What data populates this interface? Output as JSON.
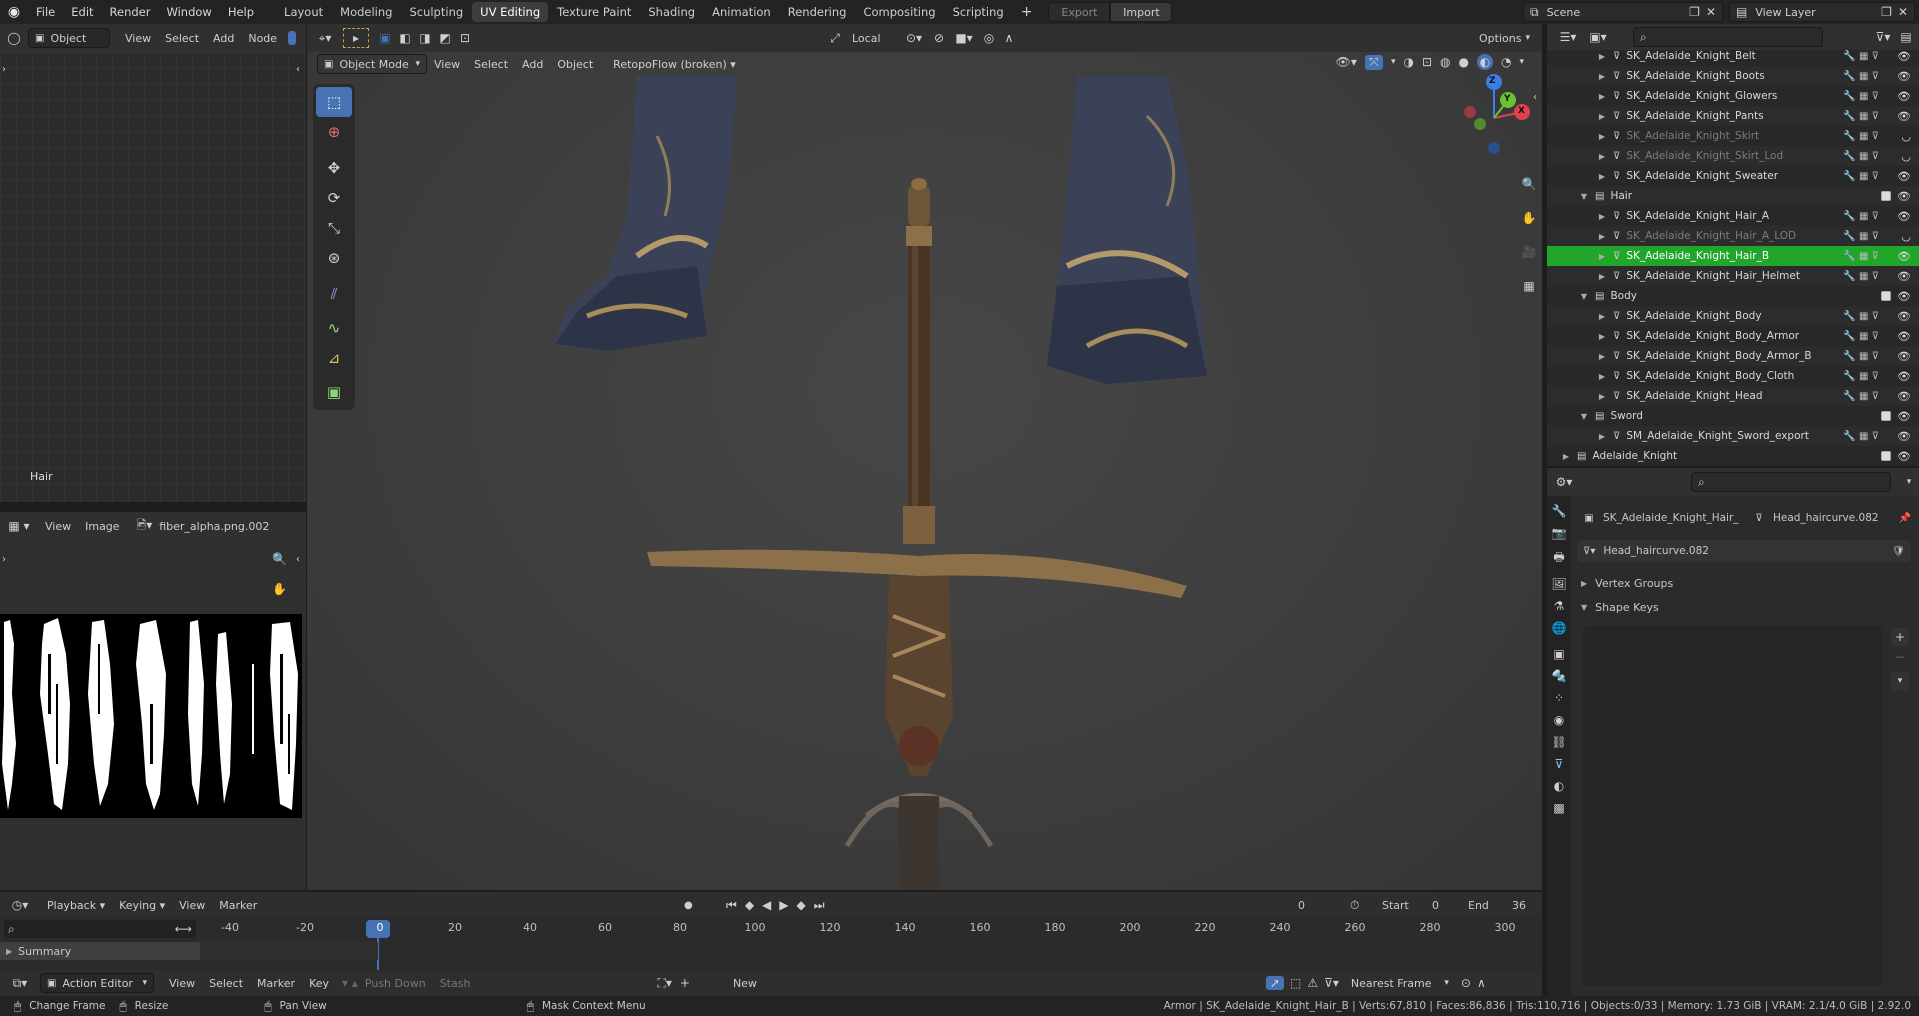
{
  "app_menu": [
    "File",
    "Edit",
    "Render",
    "Window",
    "Help"
  ],
  "workspace_tabs": [
    "Layout",
    "Modeling",
    "Sculpting",
    "UV Editing",
    "Texture Paint",
    "Shading",
    "Animation",
    "Rendering",
    "Compositing",
    "Scripting"
  ],
  "active_tab_index": 3,
  "top_right": {
    "export": "Export",
    "import": "Import",
    "scene": "Scene",
    "view_layer": "View Layer"
  },
  "uv_editor": {
    "mode": "Object",
    "menus": [
      "View",
      "Select",
      "Add",
      "Node"
    ],
    "label": "Hair"
  },
  "image_editor": {
    "menus": [
      "View",
      "Image"
    ],
    "image_name": "fiber_alpha.png.002"
  },
  "viewport_header": {
    "transform_orientation": "Local",
    "options": "Options",
    "mode": "Object Mode",
    "menus": [
      "View",
      "Select",
      "Add",
      "Object"
    ],
    "addon_menu": "RetopoFlow (broken)"
  },
  "gizmo_axes": {
    "x": "X",
    "y": "Y",
    "z": "Z"
  },
  "outliner": {
    "rows": [
      {
        "label": "SK_Adelaide_Knight_Belt",
        "indent": 2,
        "dim": false,
        "sel": false
      },
      {
        "label": "SK_Adelaide_Knight_Boots",
        "indent": 2,
        "dim": false,
        "sel": false
      },
      {
        "label": "SK_Adelaide_Knight_Glowers",
        "indent": 2,
        "dim": false,
        "sel": false
      },
      {
        "label": "SK_Adelaide_Knight_Pants",
        "indent": 2,
        "dim": false,
        "sel": false
      },
      {
        "label": "SK_Adelaide_Knight_Skirt",
        "indent": 2,
        "dim": true,
        "sel": false
      },
      {
        "label": "SK_Adelaide_Knight_Skirt_Lod",
        "indent": 2,
        "dim": true,
        "sel": false
      },
      {
        "label": "SK_Adelaide_Knight_Sweater",
        "indent": 2,
        "dim": false,
        "sel": false
      },
      {
        "label": "Hair",
        "indent": 1,
        "dim": false,
        "sel": false,
        "collection": true
      },
      {
        "label": "SK_Adelaide_Knight_Hair_A",
        "indent": 2,
        "dim": false,
        "sel": false
      },
      {
        "label": "SK_Adelaide_Knight_Hair_A_LOD",
        "indent": 2,
        "dim": true,
        "sel": false
      },
      {
        "label": "SK_Adelaide_Knight_Hair_B",
        "indent": 2,
        "dim": false,
        "sel": true
      },
      {
        "label": "SK_Adelaide_Knight_Hair_Helmet",
        "indent": 2,
        "dim": false,
        "sel": false
      },
      {
        "label": "Body",
        "indent": 1,
        "dim": false,
        "sel": false,
        "collection": true
      },
      {
        "label": "SK_Adelaide_Knight_Body",
        "indent": 2,
        "dim": false,
        "sel": false
      },
      {
        "label": "SK_Adelaide_Knight_Body_Armor",
        "indent": 2,
        "dim": false,
        "sel": false
      },
      {
        "label": "SK_Adelaide_Knight_Body_Armor_B",
        "indent": 2,
        "dim": false,
        "sel": false
      },
      {
        "label": "SK_Adelaide_Knight_Body_Cloth",
        "indent": 2,
        "dim": false,
        "sel": false
      },
      {
        "label": "SK_Adelaide_Knight_Head",
        "indent": 2,
        "dim": false,
        "sel": false
      },
      {
        "label": "Sword",
        "indent": 1,
        "dim": false,
        "sel": false,
        "collection": true
      },
      {
        "label": "SM_Adelaide_Knight_Sword_export",
        "indent": 2,
        "dim": false,
        "sel": false
      },
      {
        "label": "Adelaide_Knight",
        "indent": 0,
        "dim": false,
        "sel": false,
        "collection": true
      }
    ]
  },
  "properties": {
    "object_name": "SK_Adelaide_Knight_Hair_",
    "data_name": "Head_haircurve.082",
    "datablock": "Head_haircurve.082",
    "panels": [
      "Vertex Groups",
      "Shape Keys"
    ]
  },
  "timeline": {
    "menus": [
      "Playback",
      "Keying",
      "View",
      "Marker"
    ],
    "current_frame": "0",
    "start_label": "Start",
    "start": "0",
    "end_label": "End",
    "end": "36",
    "ticks": [
      "-40",
      "-20",
      "0",
      "20",
      "40",
      "60",
      "80",
      "100",
      "120",
      "140",
      "160",
      "180",
      "200",
      "220",
      "240",
      "260",
      "280",
      "300"
    ],
    "summary": "Summary",
    "editor": "Action Editor",
    "editor_menus": [
      "View",
      "Select",
      "Marker",
      "Key"
    ],
    "push_down": "Push Down",
    "stash": "Stash",
    "new": "New",
    "snap": "Nearest Frame"
  },
  "statusbar": {
    "change_frame": "Change Frame",
    "resize": "Resize",
    "pan_view": "Pan View",
    "mask_menu": "Mask Context Menu",
    "stats": "Armor | SK_Adelaide_Knight_Hair_B | Verts:67,810 | Faces:86,836 | Tris:110,716 | Objects:0/33 | Memory: 1.73 GiB | VRAM: 2.1/4.0 GiB | 2.92.0"
  },
  "colors": {
    "accent": "#4772b3",
    "selected_row": "#21a52b",
    "x_axis": "#e0404f",
    "y_axis": "#6ac32c",
    "z_axis": "#3b7ee8"
  }
}
